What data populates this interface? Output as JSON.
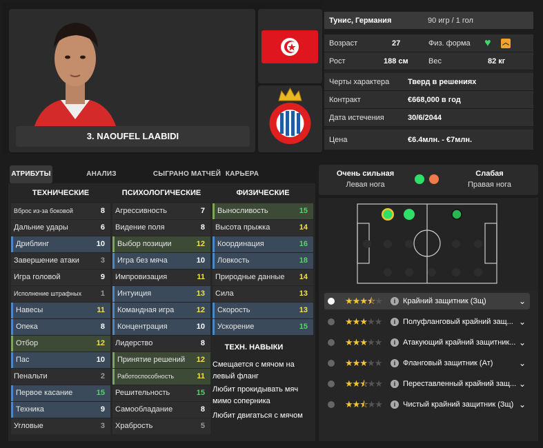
{
  "player": {
    "name": "3. NAOUFEL LAABIDI"
  },
  "info": {
    "nationality": "Тунис, Германия",
    "apps": "90 игр / 1 гол",
    "age_label": "Возраст",
    "age": "27",
    "fitness_label": "Физ. форма",
    "height_label": "Рост",
    "height": "188 см",
    "weight_label": "Вес",
    "weight": "82 кг",
    "traits_label": "Черты характера",
    "traits": "Тверд в решениях",
    "contract_label": "Контракт",
    "contract": "€668,000 в год",
    "expiry_label": "Дата истечения",
    "expiry": "30/6/2044",
    "price_label": "Цена",
    "price": "€6.4млн. - €7млн."
  },
  "tabs": [
    "АТРИБУТЫ",
    "АНАЛИЗ ХАРАКТЕРИСТИК",
    "СЫГРАНО МАТЧЕЙ",
    "КАРЬЕРА"
  ],
  "columns": {
    "technical": "ТЕХНИЧЕСКИЕ",
    "mental": "ПСИХОЛОГИЧЕСКИЕ",
    "physical": "ФИЗИЧЕСКИЕ",
    "tech_skills": "ТЕХН. НАВЫКИ"
  },
  "technical": [
    {
      "label": "Вброс из-за боковой",
      "value": "8"
    },
    {
      "label": "Дальние удары",
      "value": "6"
    },
    {
      "label": "Дриблинг",
      "value": "10"
    },
    {
      "label": "Завершение атаки",
      "value": "3"
    },
    {
      "label": "Игра головой",
      "value": "9"
    },
    {
      "label": "Исполнение штрафных",
      "value": "1"
    },
    {
      "label": "Навесы",
      "value": "11"
    },
    {
      "label": "Опека",
      "value": "8"
    },
    {
      "label": "Отбор",
      "value": "12"
    },
    {
      "label": "Пас",
      "value": "10"
    },
    {
      "label": "Пенальти",
      "value": "2"
    },
    {
      "label": "Первое касание",
      "value": "15"
    },
    {
      "label": "Техника",
      "value": "9"
    },
    {
      "label": "Угловые",
      "value": "3"
    }
  ],
  "mental": [
    {
      "label": "Агрессивность",
      "value": "7"
    },
    {
      "label": "Видение поля",
      "value": "8"
    },
    {
      "label": "Выбор позиции",
      "value": "12"
    },
    {
      "label": "Игра без мяча",
      "value": "10"
    },
    {
      "label": "Импровизация",
      "value": "11"
    },
    {
      "label": "Интуиция",
      "value": "13"
    },
    {
      "label": "Командная игра",
      "value": "12"
    },
    {
      "label": "Концентрация",
      "value": "10"
    },
    {
      "label": "Лидерство",
      "value": "8"
    },
    {
      "label": "Принятие решений",
      "value": "12"
    },
    {
      "label": "Работоспособность",
      "value": "11"
    },
    {
      "label": "Решительность",
      "value": "15"
    },
    {
      "label": "Самообладание",
      "value": "8"
    },
    {
      "label": "Храбрость",
      "value": "5"
    }
  ],
  "physical": [
    {
      "label": "Выносливость",
      "value": "15"
    },
    {
      "label": "Высота прыжка",
      "value": "14"
    },
    {
      "label": "Координация",
      "value": "16"
    },
    {
      "label": "Ловкость",
      "value": "18"
    },
    {
      "label": "Природные данные",
      "value": "14"
    },
    {
      "label": "Сила",
      "value": "13"
    },
    {
      "label": "Скорость",
      "value": "13"
    },
    {
      "label": "Ускорение",
      "value": "15"
    }
  ],
  "tech_skills": [
    "Смещается с мячом на левый фланг",
    "Любит прокидывать мяч мимо соперника",
    "Любит двигаться с мячом"
  ],
  "feet": {
    "left_level": "Очень сильная",
    "left_label": "Левая нога",
    "right_level": "Слабая",
    "right_label": "Правая нога",
    "left_color": "#2ee06a",
    "right_color": "#f07a4a"
  },
  "positions": [
    {
      "label": "Крайний защитник (Зщ)",
      "stars": 3.5
    },
    {
      "label": "Полуфланговый крайний защ...",
      "stars": 3
    },
    {
      "label": "Атакующий крайний защитник...",
      "stars": 3
    },
    {
      "label": "Фланговый защитник (Ат)",
      "stars": 3
    },
    {
      "label": "Переставленный крайний защ...",
      "stars": 2.5
    },
    {
      "label": "Чистый крайний защитник (Зщ)",
      "stars": 2.5
    }
  ]
}
